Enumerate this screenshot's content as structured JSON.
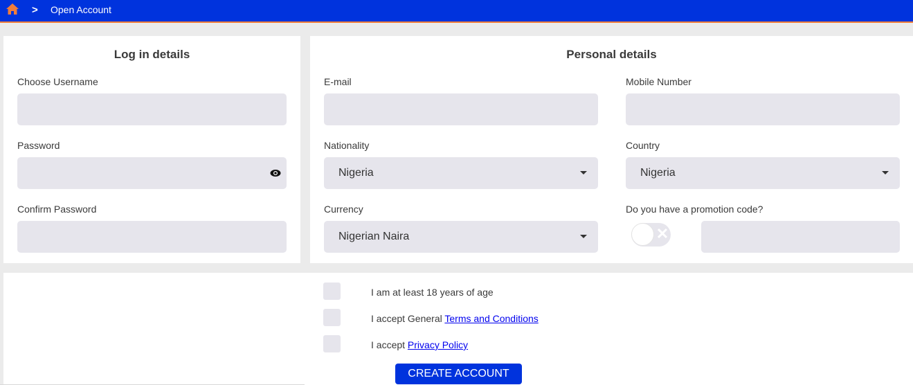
{
  "header": {
    "breadcrumb_separator": ">",
    "title": "Open Account",
    "brand_color": "#0033dd",
    "accent_color": "#f07c3a"
  },
  "login": {
    "title": "Log in details",
    "username_label": "Choose Username",
    "username_value": "",
    "password_label": "Password",
    "password_value": "",
    "confirm_password_label": "Confirm Password",
    "confirm_password_value": ""
  },
  "personal": {
    "title": "Personal details",
    "email_label": "E-mail",
    "email_value": "",
    "mobile_label": "Mobile Number",
    "mobile_value": "",
    "nationality_label": "Nationality",
    "nationality_value": "Nigeria",
    "country_label": "Country",
    "country_value": "Nigeria",
    "currency_label": "Currency",
    "currency_value": "Nigerian Naira",
    "promo_label": "Do you have a promotion code?",
    "promo_enabled": false,
    "promo_value": ""
  },
  "agreements": {
    "age_label": "I am at least 18 years of age",
    "terms_prefix": "I accept General ",
    "terms_link": "Terms and Conditions",
    "privacy_prefix": "I accept ",
    "privacy_link": "Privacy Policy",
    "age_checked": false,
    "terms_checked": false,
    "privacy_checked": false
  },
  "actions": {
    "create_label": "CREATE ACCOUNT"
  }
}
